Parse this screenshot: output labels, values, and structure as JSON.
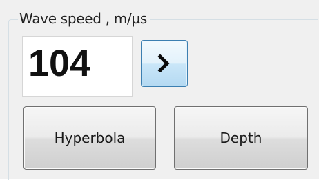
{
  "group": {
    "title": "Wave speed , m/µs"
  },
  "speed": {
    "value": "104"
  },
  "buttons": {
    "next_icon": "chevron-right-icon",
    "hyperbola_label": "Hyperbola",
    "depth_label": "Depth"
  },
  "colors": {
    "next_button_border": "#3c7fb1",
    "next_button_fill": "#c9e6f8"
  }
}
